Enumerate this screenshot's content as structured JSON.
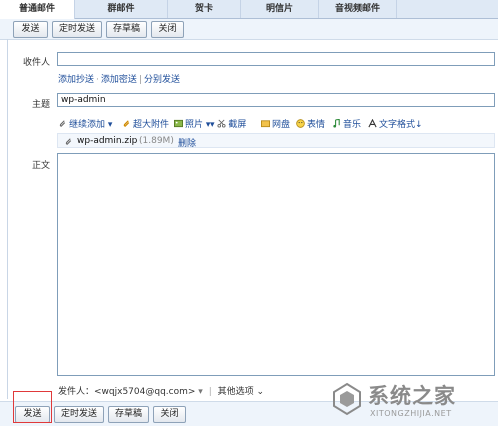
{
  "tabs": [
    "普通邮件",
    "群邮件",
    "贺卡",
    "明信片",
    "音视频邮件"
  ],
  "toolbar": {
    "send": "发送",
    "scheduled": "定时发送",
    "save_draft": "存草稿",
    "close": "关闭"
  },
  "form": {
    "recipient_label": "收件人",
    "recipient_value": "",
    "links": [
      "添加抄送",
      "添加密送",
      "分别发送"
    ],
    "subject_label": "主题",
    "subject_value": "wp-admin",
    "body_label": "正文"
  },
  "attach_toolbar": {
    "continue_add": "继续添加",
    "large_attach": "超大附件",
    "photo": "照片",
    "screenshot": "截屏",
    "netdisk": "网盘",
    "emoji": "表情",
    "music": "音乐",
    "text_format": "文字格式"
  },
  "attachment": {
    "name": "wp-admin.zip",
    "size": "(1.89M)",
    "delete": "删除"
  },
  "footer": {
    "sender_label": "发件人：",
    "sender_value": "<wqjx5704@qq.com>",
    "other_options": "其他选项"
  },
  "watermark": {
    "title": "系统之家",
    "url": "XITONGZHIJIA.NET"
  }
}
